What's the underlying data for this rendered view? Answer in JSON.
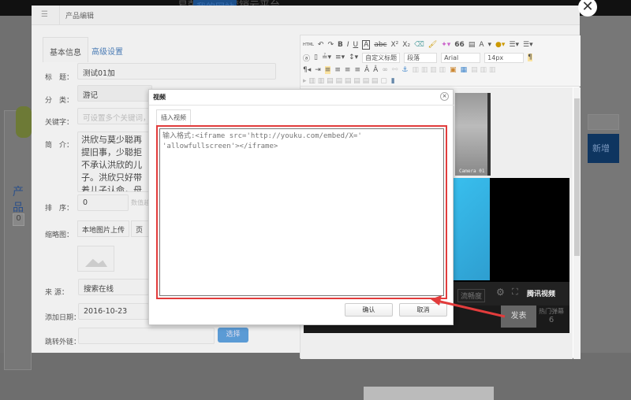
{
  "background": {
    "site_title": "易荣字移动营销云平台",
    "link": "我的网站",
    "section_title": "产品",
    "count": "0",
    "blue_button": "新增"
  },
  "modal": {
    "title": "产品编辑",
    "menu_icon": "☰",
    "close": "✕",
    "tabs": [
      "基本信息",
      "高级设置"
    ],
    "form": {
      "title_label": "标　题：",
      "title_value": "测试01加",
      "category_label": "分　类：",
      "category_value": "游记",
      "keywords_label": "关键字：",
      "keywords_placeholder": "可设置多个关键词，用",
      "intro_label": "简　介：",
      "intro_value": "洪欣与莫少聪再提旧事，少聪拒不承认洪欣的儿子。洪欣只好带着儿子认命，母子俩尝尽生活的艰辛",
      "sort_label": "排　序：",
      "sort_value": "0",
      "sort_hint": "数值越",
      "thumb_label": "缩略图：",
      "upload_local": "本地图片上传",
      "upload_page": "页面",
      "source_label": "来 源：",
      "source_value": "搜索在线",
      "date_label": "添加日期：",
      "date_value": "2016-10-23",
      "link_label": "跳转外链：",
      "link_value": "",
      "select_button": "选择"
    }
  },
  "editor": {
    "toolbar": {
      "html": "HTML",
      "bold": "B",
      "italic": "I",
      "underline": "U",
      "font_border": "A",
      "strike": "abc",
      "sup": "X²",
      "sub": "X₂",
      "quote": "66",
      "font_color": "A",
      "custom_title": "自定义标题",
      "paragraph": "段落",
      "font_family": "Arial",
      "font_size": "14px"
    },
    "thumb_caption": "Camera 01",
    "video": {
      "brand": "腾讯视频",
      "clarity": "流畅度",
      "send": "发表",
      "hot_label": "热门弹幕",
      "hot_count": "6"
    }
  },
  "dialog": {
    "title": "视频",
    "tab": "插入视频",
    "textarea_placeholder": "输入格式:<iframe src='http://youku.com/embed/X=' 'allowfullscreen'></iframe>",
    "confirm": "确认",
    "cancel": "取消",
    "close": "×"
  },
  "colors": {
    "annotation": "#e23c3c",
    "accent": "#5b9bd5"
  }
}
